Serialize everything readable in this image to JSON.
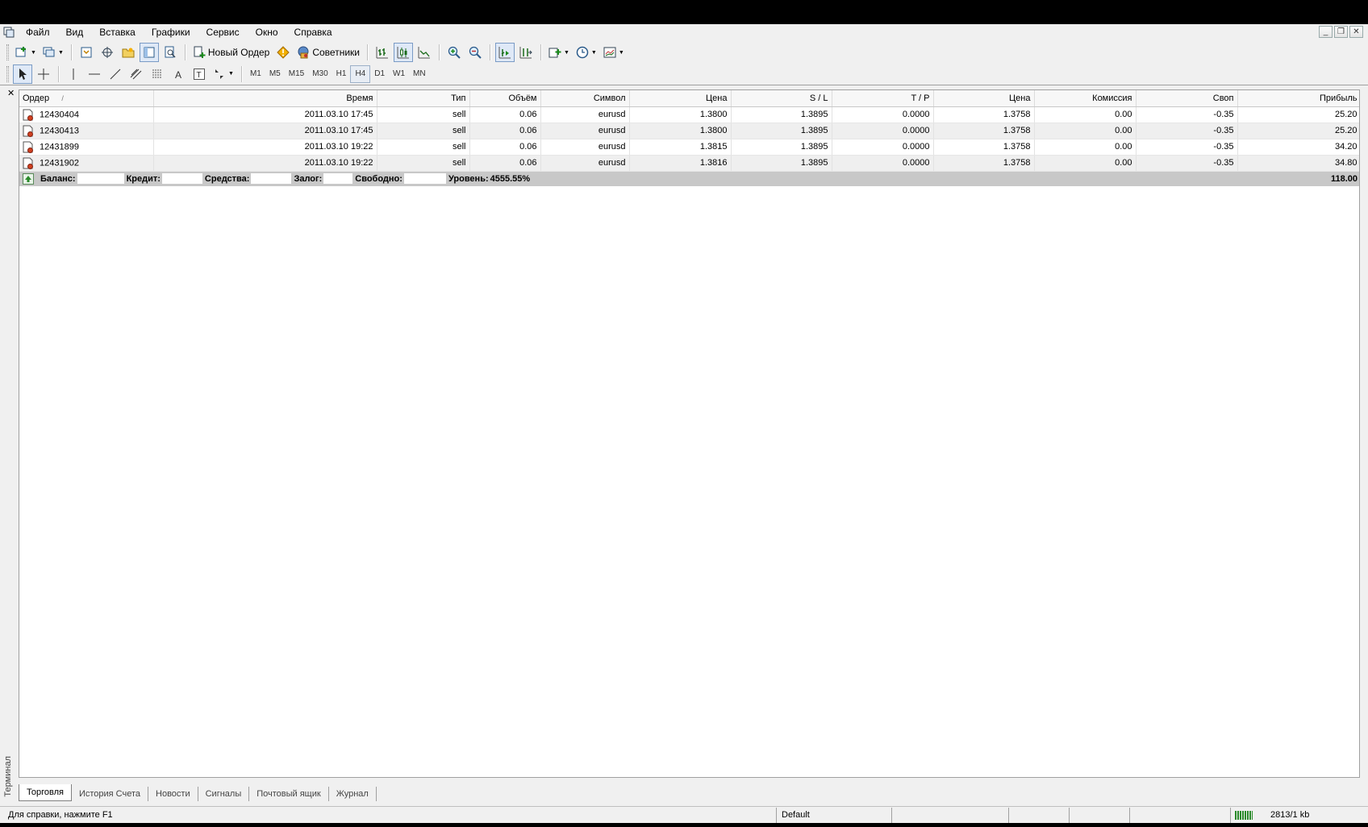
{
  "menu": [
    "Файл",
    "Вид",
    "Вставка",
    "Графики",
    "Сервис",
    "Окно",
    "Справка"
  ],
  "toolbar": {
    "new_order_label": "Новый Ордер",
    "advisors_label": "Советники"
  },
  "timeframes": [
    "M1",
    "M5",
    "M15",
    "M30",
    "H1",
    "H4",
    "D1",
    "W1",
    "MN"
  ],
  "active_timeframe": "H4",
  "terminal": {
    "side_label": "Терминал",
    "columns": [
      "Ордер",
      "Время",
      "Тип",
      "Объём",
      "Символ",
      "Цена",
      "S / L",
      "T / P",
      "Цена",
      "Комиссия",
      "Своп",
      "Прибыль"
    ],
    "sort_indicator": "/",
    "rows": [
      {
        "order": "12430404",
        "time": "2011.03.10 17:45",
        "type": "sell",
        "volume": "0.06",
        "symbol": "eurusd",
        "price": "1.3800",
        "sl": "1.3895",
        "tp": "0.0000",
        "current": "1.3758",
        "commission": "0.00",
        "swap": "-0.35",
        "profit": "25.20"
      },
      {
        "order": "12430413",
        "time": "2011.03.10 17:45",
        "type": "sell",
        "volume": "0.06",
        "symbol": "eurusd",
        "price": "1.3800",
        "sl": "1.3895",
        "tp": "0.0000",
        "current": "1.3758",
        "commission": "0.00",
        "swap": "-0.35",
        "profit": "25.20"
      },
      {
        "order": "12431899",
        "time": "2011.03.10 19:22",
        "type": "sell",
        "volume": "0.06",
        "symbol": "eurusd",
        "price": "1.3815",
        "sl": "1.3895",
        "tp": "0.0000",
        "current": "1.3758",
        "commission": "0.00",
        "swap": "-0.35",
        "profit": "34.20"
      },
      {
        "order": "12431902",
        "time": "2011.03.10 19:22",
        "type": "sell",
        "volume": "0.06",
        "symbol": "eurusd",
        "price": "1.3816",
        "sl": "1.3895",
        "tp": "0.0000",
        "current": "1.3758",
        "commission": "0.00",
        "swap": "-0.35",
        "profit": "34.80"
      }
    ],
    "summary": {
      "balance_label": "Баланс:",
      "credit_label": "Кредит:",
      "equity_label": "Средства:",
      "margin_label": "Залог:",
      "free_label": "Свободно:",
      "level_label": "Уровень:",
      "level_value": "4555.55%",
      "total_profit": "118.00"
    },
    "tabs": [
      "Торговля",
      "История Счета",
      "Новости",
      "Сигналы",
      "Почтовый ящик",
      "Журнал"
    ],
    "active_tab": "Торговля"
  },
  "status": {
    "help": "Для справки, нажмите F1",
    "profile": "Default",
    "traffic": "2813/1 kb"
  }
}
